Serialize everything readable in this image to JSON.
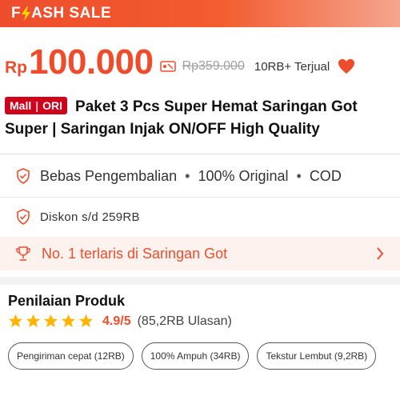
{
  "flash_sale": {
    "label_prefix": "F",
    "label_suffix": "ASH SALE",
    "icon": "lightning-bolt-icon"
  },
  "price": {
    "currency": "Rp",
    "amount": "100.000",
    "tag_icon": "price-tag-icon",
    "original": "Rp359.000",
    "sold": "10RB+ Terjual",
    "favorite_icon": "heart-icon"
  },
  "product": {
    "badge_left": "Mall",
    "badge_right": "ORI",
    "title": "Paket 3 Pcs Super Hemat Saringan Got Super | Saringan Injak ON/OFF High Quality"
  },
  "guarantees": {
    "icon": "shield-icon",
    "items": [
      "Bebas Pengembalian",
      "100% Original",
      "COD"
    ],
    "separator": "•"
  },
  "discount": {
    "icon": "shield-icon",
    "text": "Diskon s/d 259RB"
  },
  "bestseller": {
    "icon": "trophy-icon",
    "text": "No. 1 terlaris di Saringan Got",
    "chevron_icon": "chevron-right-icon"
  },
  "ratings": {
    "title": "Penilaian Produk",
    "stars": 5,
    "score": "4.9/5",
    "count": "(85,2RB Ulasan)",
    "tags": [
      "Pengiriman cepat (12RB)",
      "100% Ampuh (34RB)",
      "Tekstur Lembut (9,2RB)"
    ]
  },
  "colors": {
    "accent": "#ee4d2d",
    "mall_badge": "#d0011b",
    "star": "#ffb400"
  }
}
